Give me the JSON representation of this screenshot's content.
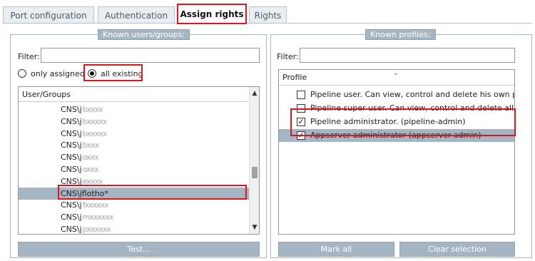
{
  "tabs": [
    {
      "label": "Port configuration"
    },
    {
      "label": "Authentication"
    },
    {
      "label": "Assign rights"
    },
    {
      "label": "Rights"
    }
  ],
  "users_panel": {
    "title": "Known users/groups:",
    "filter_label": "Filter:",
    "filter_value": "",
    "radio_assigned": "only assigned",
    "radio_all": "all existing",
    "selected_radio": "all existing",
    "column_header": "User/Groups",
    "rows": [
      {
        "prefix": "CNS\\j",
        "masked": "bxxxx"
      },
      {
        "prefix": "CNS\\j",
        "masked": "bxxxxx"
      },
      {
        "prefix": "CNS\\j",
        "masked": "bxxxxx"
      },
      {
        "prefix": "CNS\\j",
        "masked": "bxxx"
      },
      {
        "prefix": "CNS\\j",
        "masked": "oxxx"
      },
      {
        "prefix": "CNS\\j",
        "masked": "oxxx"
      },
      {
        "prefix": "CNS\\j",
        "masked": "exxxx"
      },
      {
        "prefix": "CNS\\jflotho*",
        "masked": ""
      },
      {
        "prefix": "CNS\\j",
        "masked": "fxxxxxx"
      },
      {
        "prefix": "CNS\\j",
        "masked": "mxxxxxx"
      },
      {
        "prefix": "CNS\\j",
        "masked": "pxxxxxx"
      }
    ],
    "selected_row": "CNS\\jflotho*",
    "scroll_position": 0.72,
    "test_button": "Test..."
  },
  "profiles_panel": {
    "title": "Known profiles:",
    "filter_label": "Filter:",
    "filter_value": "",
    "column_header": "Profile",
    "profiles": [
      {
        "label": "Pipeline user. Can view, control and delete his own pipe...",
        "checked": false
      },
      {
        "label": "Pipeline super user. Can view, control and delete all pip...",
        "checked": false
      },
      {
        "label": "Pipeline administrator. (pipeline-admin)",
        "checked": true
      },
      {
        "label": "Appserver administrator (appserver-admin)",
        "checked": true
      }
    ],
    "mark_all_button": "Mark all",
    "clear_selection_button": "Clear selection"
  },
  "colors": {
    "highlight": "#e0141e",
    "selection": "#a6b5c2"
  }
}
